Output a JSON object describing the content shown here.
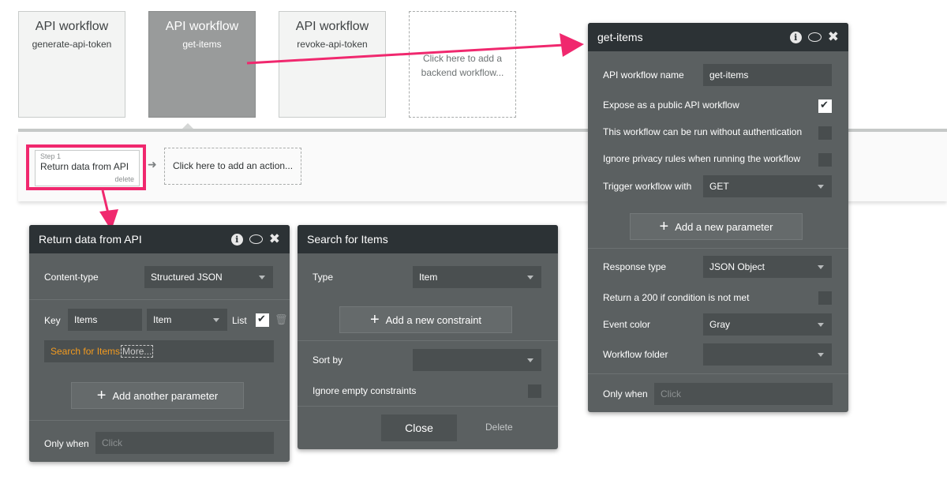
{
  "workflows": [
    {
      "title": "API workflow",
      "name": "generate-api-token"
    },
    {
      "title": "API workflow",
      "name": "get-items"
    },
    {
      "title": "API workflow",
      "name": "revoke-api-token"
    }
  ],
  "add_workflow": "Click here to add a backend workflow...",
  "step": {
    "number": "Step 1",
    "action": "Return data from API",
    "delete": "delete"
  },
  "add_action": "Click here to add an action...",
  "return_panel": {
    "title": "Return data from API",
    "content_type_label": "Content-type",
    "content_type_value": "Structured JSON",
    "key_label": "Key",
    "key_value": "Items",
    "type_value": "Item",
    "list_label": "List",
    "expression": "Search for Items",
    "expression_more": "More...",
    "add_param": "Add another parameter",
    "only_when": "Only when",
    "only_when_placeholder": "Click"
  },
  "search_panel": {
    "title": "Search for Items",
    "type_label": "Type",
    "type_value": "Item",
    "add_constraint": "Add a new constraint",
    "sort_by": "Sort by",
    "ignore_empty": "Ignore empty constraints",
    "close": "Close",
    "delete": "Delete"
  },
  "getitems_panel": {
    "title": "get-items",
    "name_label": "API workflow name",
    "name_value": "get-items",
    "expose": "Expose as a public API workflow",
    "no_auth": "This workflow can be run without authentication",
    "ignore_privacy": "Ignore privacy rules when running the workflow",
    "trigger_label": "Trigger workflow with",
    "trigger_value": "GET",
    "add_param": "Add a new parameter",
    "response_label": "Response type",
    "response_value": "JSON Object",
    "return200": "Return a 200 if condition is not met",
    "event_color_label": "Event color",
    "event_color_value": "Gray",
    "folder_label": "Workflow folder",
    "only_when": "Only when",
    "only_when_placeholder": "Click"
  },
  "colors": {
    "highlight": "#f0286e",
    "panel_bg": "#5b6061",
    "panel_header": "#2c3235",
    "orange_text": "#f39b1f"
  }
}
